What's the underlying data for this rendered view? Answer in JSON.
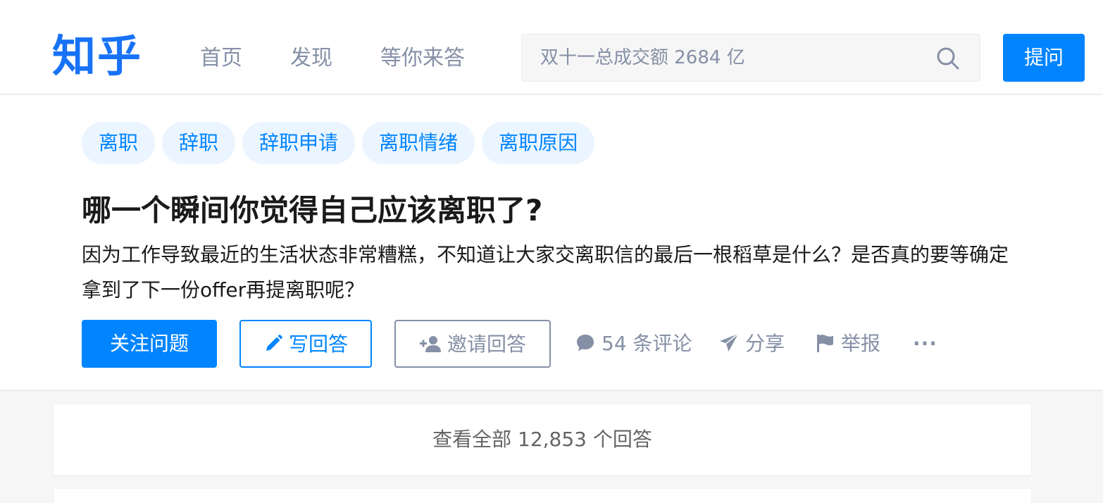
{
  "header": {
    "logo": "知乎",
    "nav": [
      "首页",
      "发现",
      "等你来答"
    ],
    "search": {
      "placeholder": "双十一总成交额 2684 亿",
      "icon": "search-icon"
    },
    "ask_button": "提问"
  },
  "question": {
    "tags": [
      "离职",
      "辞职",
      "辞职申请",
      "离职情绪",
      "离职原因"
    ],
    "title": "哪一个瞬间你觉得自己应该离职了?",
    "detail": "因为工作导致最近的生活状态非常糟糕，不知道让大家交离职信的最后一根稻草是什么？是否真的要等确定拿到了下一份offer再提离职呢？",
    "actions": {
      "follow": "关注问题",
      "write": "写回答",
      "invite": "邀请回答",
      "comments": "54 条评论",
      "share": "分享",
      "report": "举报",
      "more": "···"
    }
  },
  "answers": {
    "view_all": "查看全部 12,853 个回答"
  },
  "colors": {
    "brand": "#0084ff",
    "logo": "#1772f6",
    "muted": "#8590a6",
    "tag_bg": "#ebf5ff"
  }
}
